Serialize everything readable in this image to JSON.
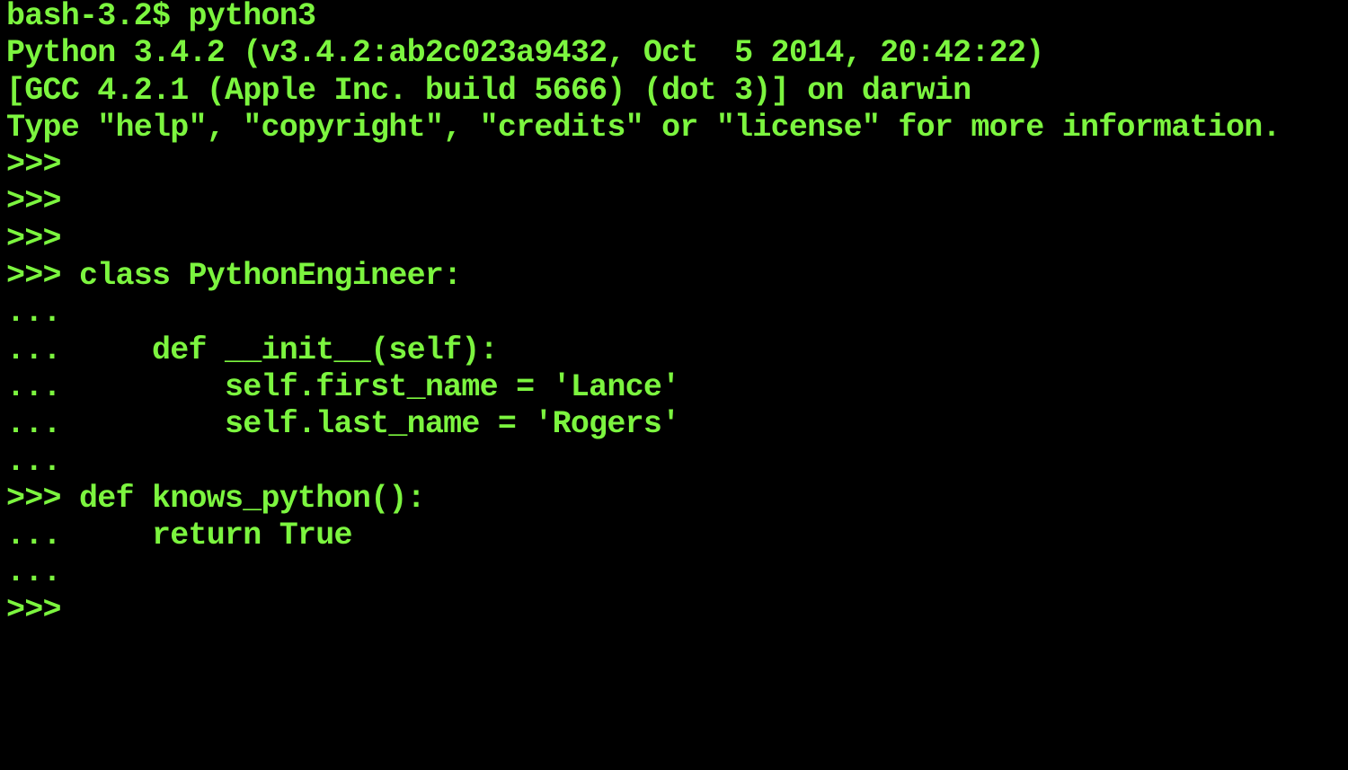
{
  "theme": {
    "background": "#000000",
    "foreground": "#7CF53F"
  },
  "terminal": {
    "lines": [
      "bash-3.2$ python3",
      "Python 3.4.2 (v3.4.2:ab2c023a9432, Oct  5 2014, 20:42:22)",
      "[GCC 4.2.1 (Apple Inc. build 5666) (dot 3)] on darwin",
      "Type \"help\", \"copyright\", \"credits\" or \"license\" for more information.",
      ">>>",
      ">>>",
      ">>>",
      ">>> class PythonEngineer:",
      "...",
      "...     def __init__(self):",
      "...         self.first_name = 'Lance'",
      "...         self.last_name = 'Rogers'",
      "...",
      ">>> def knows_python():",
      "...     return True",
      "...",
      ">>>"
    ]
  }
}
